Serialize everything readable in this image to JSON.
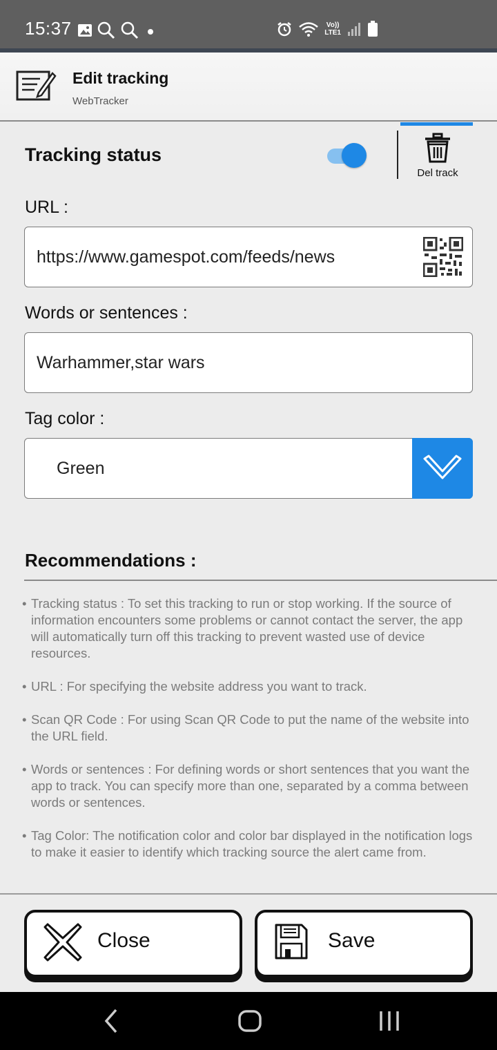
{
  "status_bar": {
    "time": "15:37",
    "left_icons": [
      "gallery-icon",
      "search-icon",
      "search-icon",
      "dot-icon"
    ],
    "right_icons": [
      "alarm-icon",
      "wifi-icon",
      "volte-lte-icon",
      "signal-icon",
      "battery-icon"
    ],
    "lte_top": "Vo))",
    "lte_bottom": "LTE1"
  },
  "header": {
    "title": "Edit tracking",
    "subtitle": "WebTracker"
  },
  "tracking": {
    "label": "Tracking status",
    "enabled": true,
    "delete_label": "Del track"
  },
  "url": {
    "label": "URL :",
    "value": "https://www.gamespot.com/feeds/news"
  },
  "words": {
    "label": "Words or sentences :",
    "value": "Warhammer,star wars"
  },
  "tag_color": {
    "label": "Tag color :",
    "value": "Green"
  },
  "recommendations": {
    "title": "Recommendations :",
    "bullet": "•",
    "items": [
      "Tracking status : To set this tracking to run or stop working. If the source of information encounters some problems or cannot contact the server, the app will automatically turn off this tracking to prevent wasted use of device resources.",
      "URL : For specifying the website address you want to track.",
      "Scan QR Code : For using Scan QR Code to put the name of the website into the URL field.",
      "Words or sentences : For defining words or short sentences that you want the app to track. You can specify more than one, separated by a comma between words or sentences.",
      "Tag Color: The notification color and color bar displayed in the notification logs to make it easier to identify which tracking source the alert came from."
    ]
  },
  "buttons": {
    "close": "Close",
    "save": "Save"
  },
  "colors": {
    "accent": "#1e88e5",
    "status_bar": "#5f5f5f",
    "background": "#ececec"
  }
}
